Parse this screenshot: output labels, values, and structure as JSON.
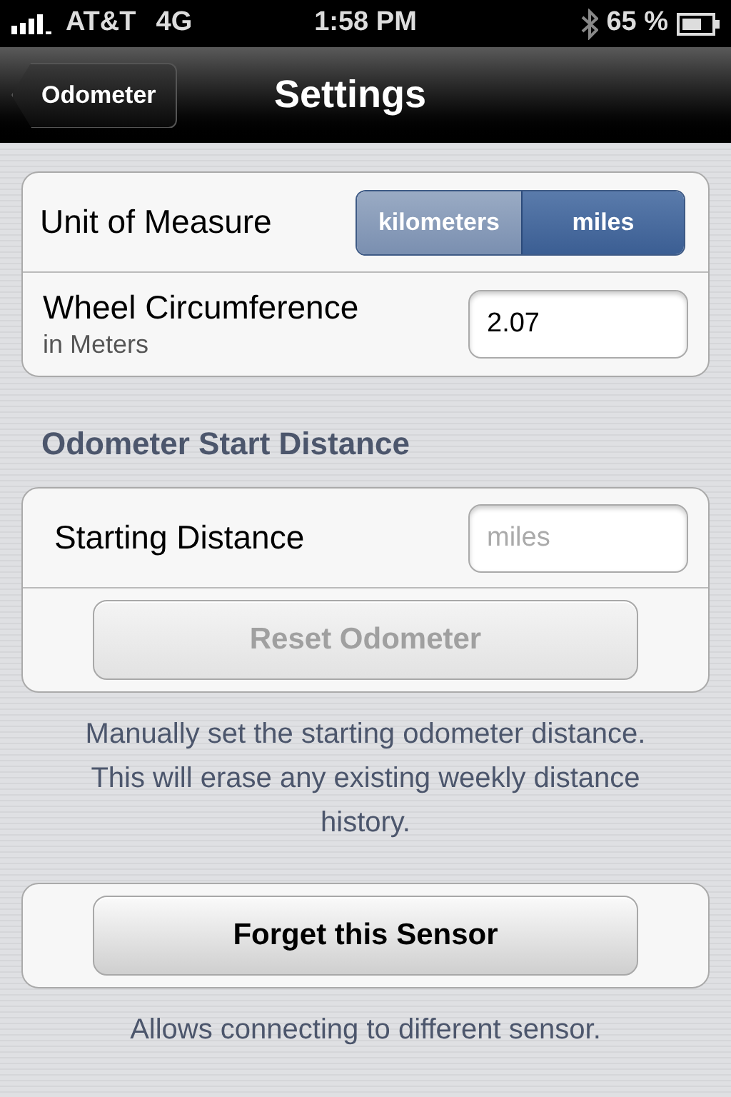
{
  "status_bar": {
    "carrier": "AT&T",
    "network": "4G",
    "time": "1:58 PM",
    "battery_percent": "65 %"
  },
  "nav_bar": {
    "back_button": "Odometer",
    "title": "Settings"
  },
  "unit_group": {
    "unit_label": "Unit of Measure",
    "segments": [
      {
        "label": "kilometers",
        "selected": false
      },
      {
        "label": "miles",
        "selected": true
      }
    ],
    "wheel_label": "Wheel Circumference",
    "wheel_sublabel": "in Meters",
    "wheel_value": "2.07"
  },
  "odometer_section": {
    "header": "Odometer Start Distance",
    "starting_label": "Starting Distance",
    "starting_placeholder": "miles",
    "reset_button": {
      "label": "Reset Odometer",
      "disabled": true
    },
    "footer": "Manually set the starting odometer distance. This will erase any existing weekly distance history."
  },
  "sensor_section": {
    "forget_button": "Forget this Sensor",
    "footer": "Allows connecting to different sensor."
  }
}
